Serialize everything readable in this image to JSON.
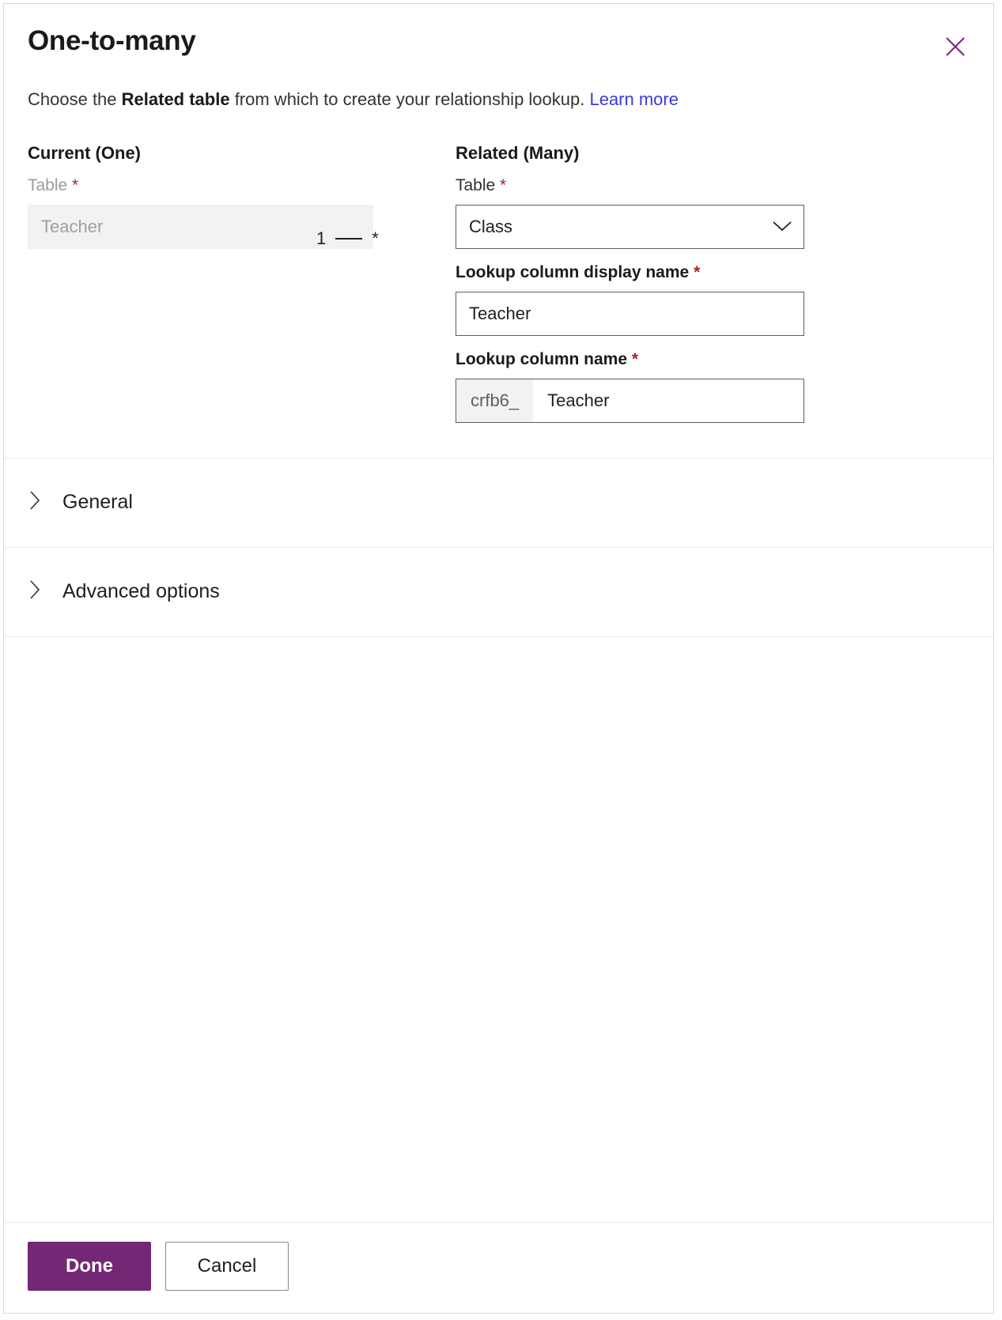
{
  "dialog": {
    "title": "One-to-many",
    "close_icon": "close-icon",
    "subtitle": {
      "before": "Choose the ",
      "bold": "Related table",
      "after": " from which to create your relationship lookup. ",
      "link": "Learn more"
    }
  },
  "current": {
    "heading": "Current (One)",
    "table_label": "Table",
    "required_mark": "*",
    "table_value": "Teacher"
  },
  "cardinality": {
    "one": "1",
    "many": "*"
  },
  "related": {
    "heading": "Related (Many)",
    "table_label": "Table",
    "table_value": "Class",
    "table_dropdown_icon": "chevron-down-icon",
    "display_name_label": "Lookup column display name",
    "display_name_value": "Teacher",
    "column_name_label": "Lookup column name",
    "column_name_prefix": "crfb6_",
    "column_name_value": "Teacher",
    "required_mark": "*"
  },
  "sections": [
    {
      "label": "General",
      "icon": "chevron-right-icon",
      "expanded": false
    },
    {
      "label": "Advanced options",
      "icon": "chevron-right-icon",
      "expanded": false
    }
  ],
  "footer": {
    "done_label": "Done",
    "cancel_label": "Cancel"
  },
  "colors": {
    "primary": "#742774",
    "link": "#3b3bdb",
    "required": "#a4262c",
    "disabled_bg": "#f3f2f1",
    "border": "#605e5c"
  }
}
